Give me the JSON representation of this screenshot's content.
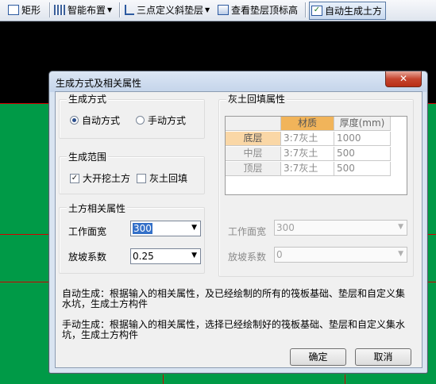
{
  "toolbar": {
    "rect_label": "矩形",
    "smart_layout_label": "智能布置",
    "three_point_label": "三点定义斜垫层",
    "view_top_label": "查看垫层顶标高",
    "auto_earthwork_label": "自动生成土方"
  },
  "dialog": {
    "title": "生成方式及相关属性",
    "close": "✕",
    "mode_group": {
      "label": "生成方式",
      "auto": "自动方式",
      "manual": "手动方式",
      "selected": "auto"
    },
    "range_group": {
      "label": "生成范围",
      "excavation": "大开挖土方",
      "excavation_checked": true,
      "backfill": "灰土回填",
      "backfill_checked": false
    },
    "earth_group": {
      "label": "土方相关属性",
      "work_width_label": "工作面宽",
      "work_width_value": "300",
      "slope_label": "放坡系数",
      "slope_value": "0.25"
    },
    "backfill_group": {
      "label": "灰土回填属性",
      "headers": [
        "材质",
        "厚度(mm)"
      ],
      "rows": [
        {
          "name": "底层",
          "material": "3:7灰土",
          "thickness": "1000"
        },
        {
          "name": "中层",
          "material": "3:7灰土",
          "thickness": "500"
        },
        {
          "name": "顶层",
          "material": "3:7灰土",
          "thickness": "500"
        }
      ],
      "work_width_label": "工作面宽",
      "work_width_value": "300",
      "slope_label": "放坡系数",
      "slope_value": "0"
    },
    "auto_desc": "自动生成：根据输入的相关属性，及已经绘制的所有的筏板基础、垫层和自定义集水坑，生成土方构件",
    "manual_desc": "手动生成：根据输入的相关属性，选择已经绘制好的筏板基础、垫层和自定义集水坑，生成土方构件",
    "ok": "确定",
    "cancel": "取消"
  }
}
